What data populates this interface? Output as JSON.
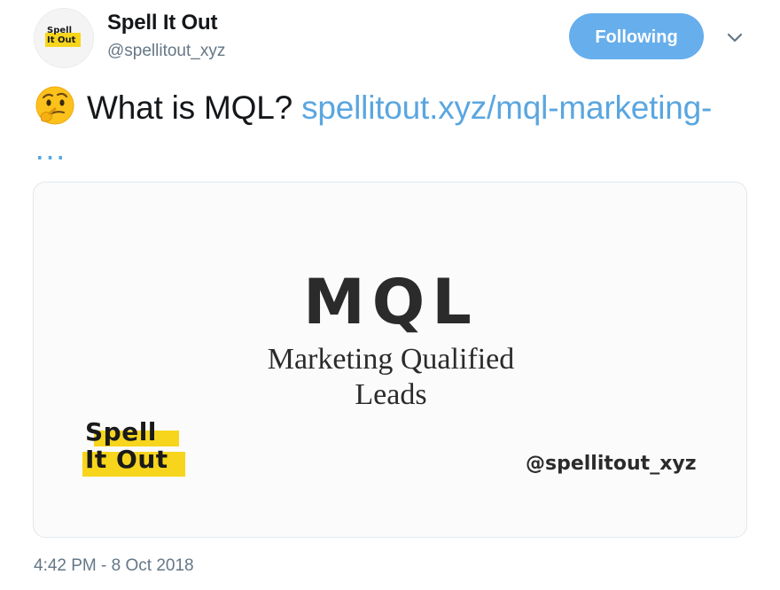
{
  "author": {
    "display_name": "Spell It Out",
    "handle": "@spellitout_xyz",
    "avatar_logo_line1": "Spell",
    "avatar_logo_line2": "It Out"
  },
  "follow_button": {
    "label": "Following",
    "color": "#66aeec"
  },
  "menu": {
    "icon": "chevron-down-icon"
  },
  "tweet": {
    "emoji": "thinking-face-icon",
    "text": "What is MQL?",
    "link_text": "spellitout.xyz/mql-marketing- …"
  },
  "card": {
    "title": "MQL",
    "subtitle_line1": "Marketing Qualified",
    "subtitle_line2": "Leads",
    "logo_line1": "Spell",
    "logo_line2": "It Out",
    "handle": "@spellitout_xyz",
    "accent_color": "#f7d51d"
  },
  "timestamp": "4:42 PM - 8 Oct 2018",
  "colors": {
    "link": "#5aa6e0",
    "secondary_text": "#657786",
    "primary_text": "#14171a"
  }
}
